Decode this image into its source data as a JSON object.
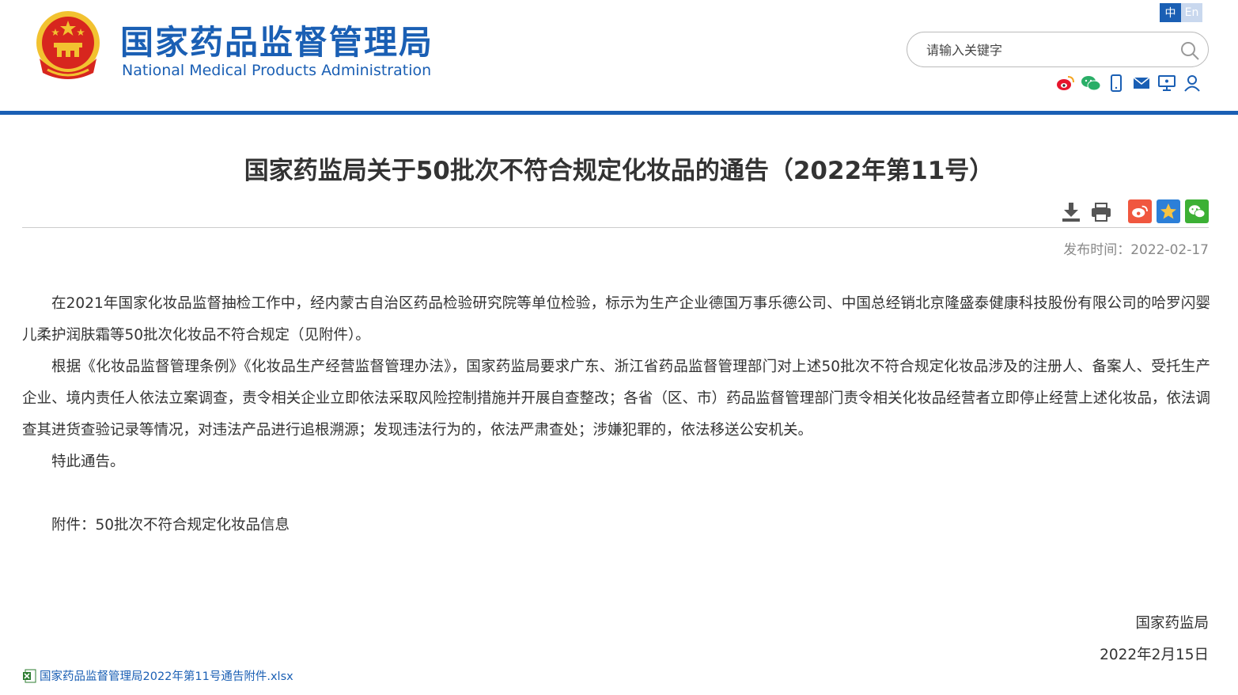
{
  "header": {
    "title_cn": "国家药品监督管理局",
    "title_en": "National Medical Products Administration",
    "lang_cn": "中",
    "lang_en": "En",
    "search_placeholder": "请输入关键字",
    "social_icons": [
      "weibo-icon",
      "wechat-icon",
      "mobile-icon",
      "mail-icon",
      "screen-icon",
      "user-icon"
    ]
  },
  "article": {
    "title": "国家药监局关于50批次不符合规定化妆品的通告（2022年第11号）",
    "publish_date": "发布时间：2022-02-17",
    "paragraphs": [
      "在2021年国家化妆品监督抽检工作中，经内蒙古自治区药品检验研究院等单位检验，标示为生产企业德国万事乐德公司、中国总经销北京隆盛泰健康科技股份有限公司的哈罗闪婴儿柔护润肤霜等50批次化妆品不符合规定（见附件）。",
      "根据《化妆品监督管理条例》《化妆品生产经营监督管理办法》，国家药监局要求广东、浙江省药品监督管理部门对上述50批次不符合规定化妆品涉及的注册人、备案人、受托生产企业、境内责任人依法立案调查，责令相关企业立即依法采取风险控制措施并开展自查整改；各省（区、市）药品监督管理部门责令相关化妆品经营者立即停止经营上述化妆品，依法调查其进货查验记录等情况，对违法产品进行追根溯源；发现违法行为的，依法严肃查处；涉嫌犯罪的，依法移送公安机关。",
      "特此通告。"
    ],
    "attachment_note": "附件：50批次不符合规定化妆品信息",
    "signature_org": "国家药监局",
    "signature_date": "2022年2月15日",
    "attachment_file": "国家药品监督管理局2022年第11号通告附件.xlsx"
  },
  "colors": {
    "brand_blue": "#1a5fb4",
    "emblem_red": "#d7261e",
    "emblem_gold": "#f2c230"
  }
}
